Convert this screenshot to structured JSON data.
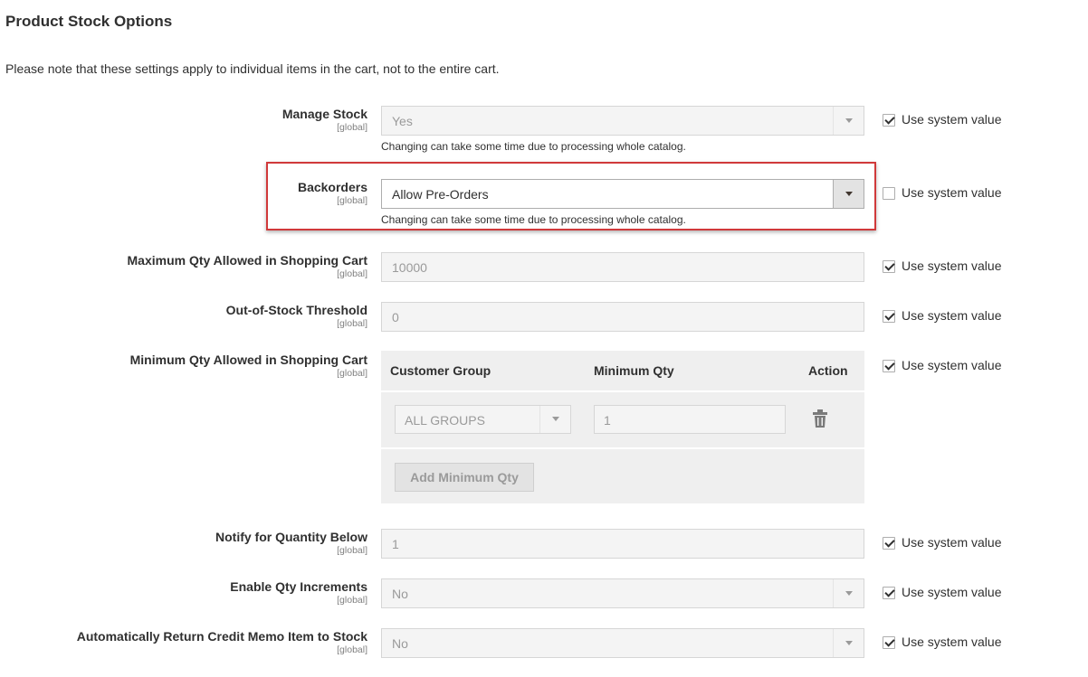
{
  "section_title": "Product Stock Options",
  "note": "Please note that these settings apply to individual items in the cart, not to the entire cart.",
  "use_system_value_label": "Use system value",
  "scope_label": "[global]",
  "manage_stock": {
    "label": "Manage Stock",
    "value": "Yes",
    "hint": "Changing can take some time due to processing whole catalog.",
    "use_system": true
  },
  "backorders": {
    "label": "Backorders",
    "value": "Allow Pre-Orders",
    "hint": "Changing can take some time due to processing whole catalog.",
    "use_system": false
  },
  "max_qty": {
    "label": "Maximum Qty Allowed in Shopping Cart",
    "value": "10000",
    "use_system": true
  },
  "out_of_stock": {
    "label": "Out-of-Stock Threshold",
    "value": "0",
    "use_system": true
  },
  "min_qty": {
    "label": "Minimum Qty Allowed in Shopping Cart",
    "use_system": true,
    "columns": [
      "Customer Group",
      "Minimum Qty",
      "Action"
    ],
    "rows": [
      {
        "group": "ALL GROUPS",
        "qty": "1"
      }
    ],
    "add_button": "Add Minimum Qty"
  },
  "notify_below": {
    "label": "Notify for Quantity Below",
    "value": "1",
    "use_system": true
  },
  "qty_increments": {
    "label": "Enable Qty Increments",
    "value": "No",
    "use_system": true
  },
  "credit_memo": {
    "label": "Automatically Return Credit Memo Item to Stock",
    "value": "No",
    "use_system": true
  },
  "colors": {
    "highlight": "#d0393a"
  }
}
